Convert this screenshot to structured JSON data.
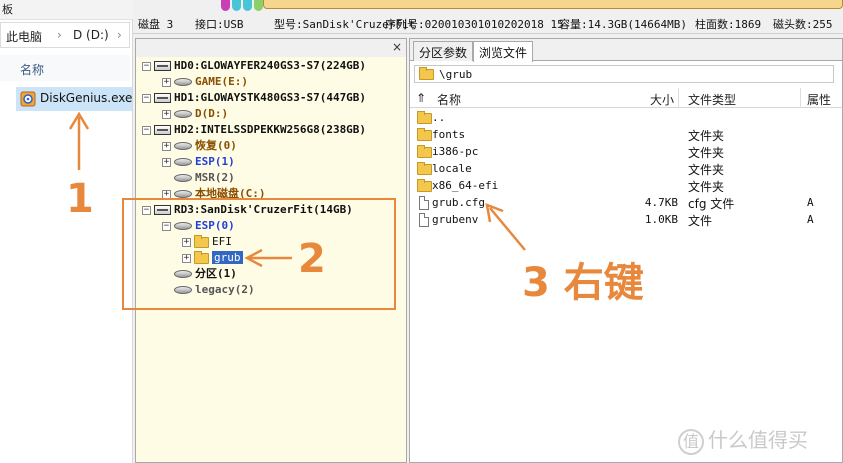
{
  "explorer": {
    "topbar_text": "板",
    "breadcrumb": [
      "此电脑",
      "D (D:)"
    ],
    "column_name": "名称",
    "file_name": "DiskGenius.exe",
    "file_icon": "diskgenius-app-icon"
  },
  "disk_info": {
    "disk": "磁盘 3",
    "interface": "接口:USB",
    "model": "型号:SanDisk'CruzerFit",
    "serial": "序列号:020010301010202018 15",
    "capacity": "容量:14.3GB(14664MB)",
    "cylinders": "柱面数:1869",
    "heads": "磁头数:255"
  },
  "tree": {
    "close_label": "×",
    "nodes": {
      "hd0": "HD0:GLOWAYFER240GS3-S7(224GB)",
      "hd0_game": "GAME(E:)",
      "hd1": "HD1:GLOWAYSTK480GS3-S7(447GB)",
      "hd1_d": "D(D:)",
      "hd2": "HD2:INTELSSDPEKKW256G8(238GB)",
      "hd2_recover": "恢复(0)",
      "hd2_esp": "ESP(1)",
      "hd2_msr": "MSR(2)",
      "hd2_local": "本地磁盘(C:)",
      "rd3": "RD3:SanDisk'CruzerFit(14GB)",
      "rd3_esp": "ESP(0)",
      "efi": "EFI",
      "grub": "grub",
      "rd3_part1": "分区(1)",
      "legacy": "legacy(2)"
    }
  },
  "right_pane": {
    "tabs": [
      "分区参数",
      "浏览文件"
    ],
    "active_tab": "浏览文件",
    "path": "\\grub",
    "columns": {
      "name": "名称",
      "size": "大小",
      "type": "文件类型",
      "attr": "属性"
    },
    "rows": [
      {
        "name": "..",
        "size": "",
        "type": "",
        "attr": "",
        "icon": "folder-icon"
      },
      {
        "name": "fonts",
        "size": "",
        "type": "文件夹",
        "attr": "",
        "icon": "folder-icon"
      },
      {
        "name": "i386-pc",
        "size": "",
        "type": "文件夹",
        "attr": "",
        "icon": "folder-icon"
      },
      {
        "name": "locale",
        "size": "",
        "type": "文件夹",
        "attr": "",
        "icon": "folder-icon"
      },
      {
        "name": "x86_64-efi",
        "size": "",
        "type": "文件夹",
        "attr": "",
        "icon": "folder-icon"
      },
      {
        "name": "grub.cfg",
        "size": "4.7KB",
        "type": "cfg 文件",
        "attr": "A",
        "icon": "file-icon"
      },
      {
        "name": "grubenv",
        "size": "1.0KB",
        "type": "文件",
        "attr": "A",
        "icon": "file-icon"
      }
    ]
  },
  "annotations": {
    "step1": "1",
    "step2": "2",
    "step3": "3 右键",
    "color": "#e7883c"
  },
  "watermark": {
    "symbol": "值",
    "text": "什么值得买"
  }
}
